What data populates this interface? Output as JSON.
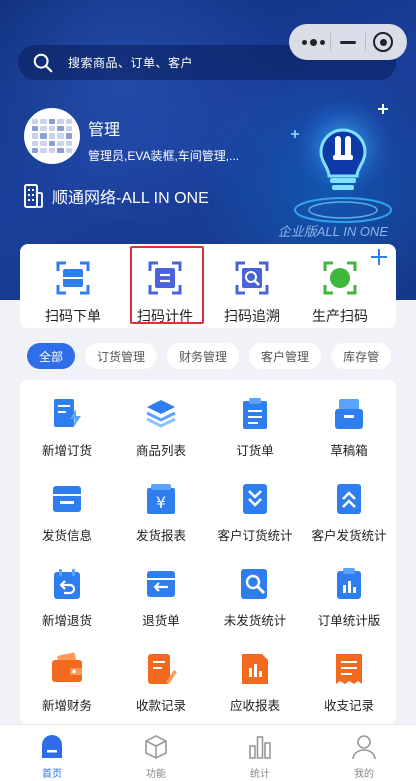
{
  "search": {
    "placeholder": "搜索商品、订单、客户"
  },
  "user": {
    "name": "管理",
    "roles": "管理员,EVA装框,车间管理,...",
    "company": "顺通网络-ALL IN ONE",
    "edition": "企业版ALL IN ONE"
  },
  "colors": {
    "accent": "#2f6ee8",
    "hero": "#163889",
    "highlight": "#e0313a",
    "orange": "#f36a1f"
  },
  "quick_actions": [
    {
      "label": "扫码下单",
      "icon": "scan-order-icon",
      "color": "#2f7ef0"
    },
    {
      "label": "扫码计件",
      "icon": "scan-piece-icon",
      "color": "#4a63d8"
    },
    {
      "label": "扫码追溯",
      "icon": "scan-trace-icon",
      "color": "#4a63d8"
    },
    {
      "label": "生产扫码",
      "icon": "scan-production-icon",
      "color": "#3fb73a"
    }
  ],
  "chips": [
    "全部",
    "订货管理",
    "财务管理",
    "客户管理",
    "库存管"
  ],
  "grid": [
    {
      "label": "新增订货",
      "icon": "new-order-icon",
      "color": "#2f7ef0"
    },
    {
      "label": "商品列表",
      "icon": "product-list-icon",
      "color": "#2f7ef0"
    },
    {
      "label": "订货单",
      "icon": "order-form-icon",
      "color": "#2f7ef0"
    },
    {
      "label": "草稿箱",
      "icon": "draft-box-icon",
      "color": "#2f7ef0"
    },
    {
      "label": "发货信息",
      "icon": "shipment-info-icon",
      "color": "#2f7ef0"
    },
    {
      "label": "发货报表",
      "icon": "shipment-report-icon",
      "color": "#2f7ef0"
    },
    {
      "label": "客户订货统计",
      "icon": "customer-order-stats-icon",
      "color": "#2f7ef0"
    },
    {
      "label": "客户发货统计",
      "icon": "customer-shipment-stats-icon",
      "color": "#2f7ef0"
    },
    {
      "label": "新增退货",
      "icon": "new-return-icon",
      "color": "#2f7ef0"
    },
    {
      "label": "退货单",
      "icon": "return-form-icon",
      "color": "#2f7ef0"
    },
    {
      "label": "未发货统计",
      "icon": "unshipped-stats-icon",
      "color": "#2f7ef0"
    },
    {
      "label": "订单统计版",
      "icon": "order-stats-icon",
      "color": "#2f7ef0"
    },
    {
      "label": "新增财务",
      "icon": "wallet-icon",
      "color": "#f36a1f"
    },
    {
      "label": "收款记录",
      "icon": "receipt-record-icon",
      "color": "#f36a1f"
    },
    {
      "label": "应收报表",
      "icon": "receivable-report-icon",
      "color": "#f36a1f"
    },
    {
      "label": "收支记录",
      "icon": "income-expense-icon",
      "color": "#f36a1f"
    }
  ],
  "tabs": [
    {
      "label": "首页",
      "icon": "home-icon",
      "active": true
    },
    {
      "label": "功能",
      "icon": "cube-icon",
      "active": false
    },
    {
      "label": "统计",
      "icon": "bar-chart-icon",
      "active": false
    },
    {
      "label": "我的",
      "icon": "user-icon",
      "active": false
    }
  ]
}
